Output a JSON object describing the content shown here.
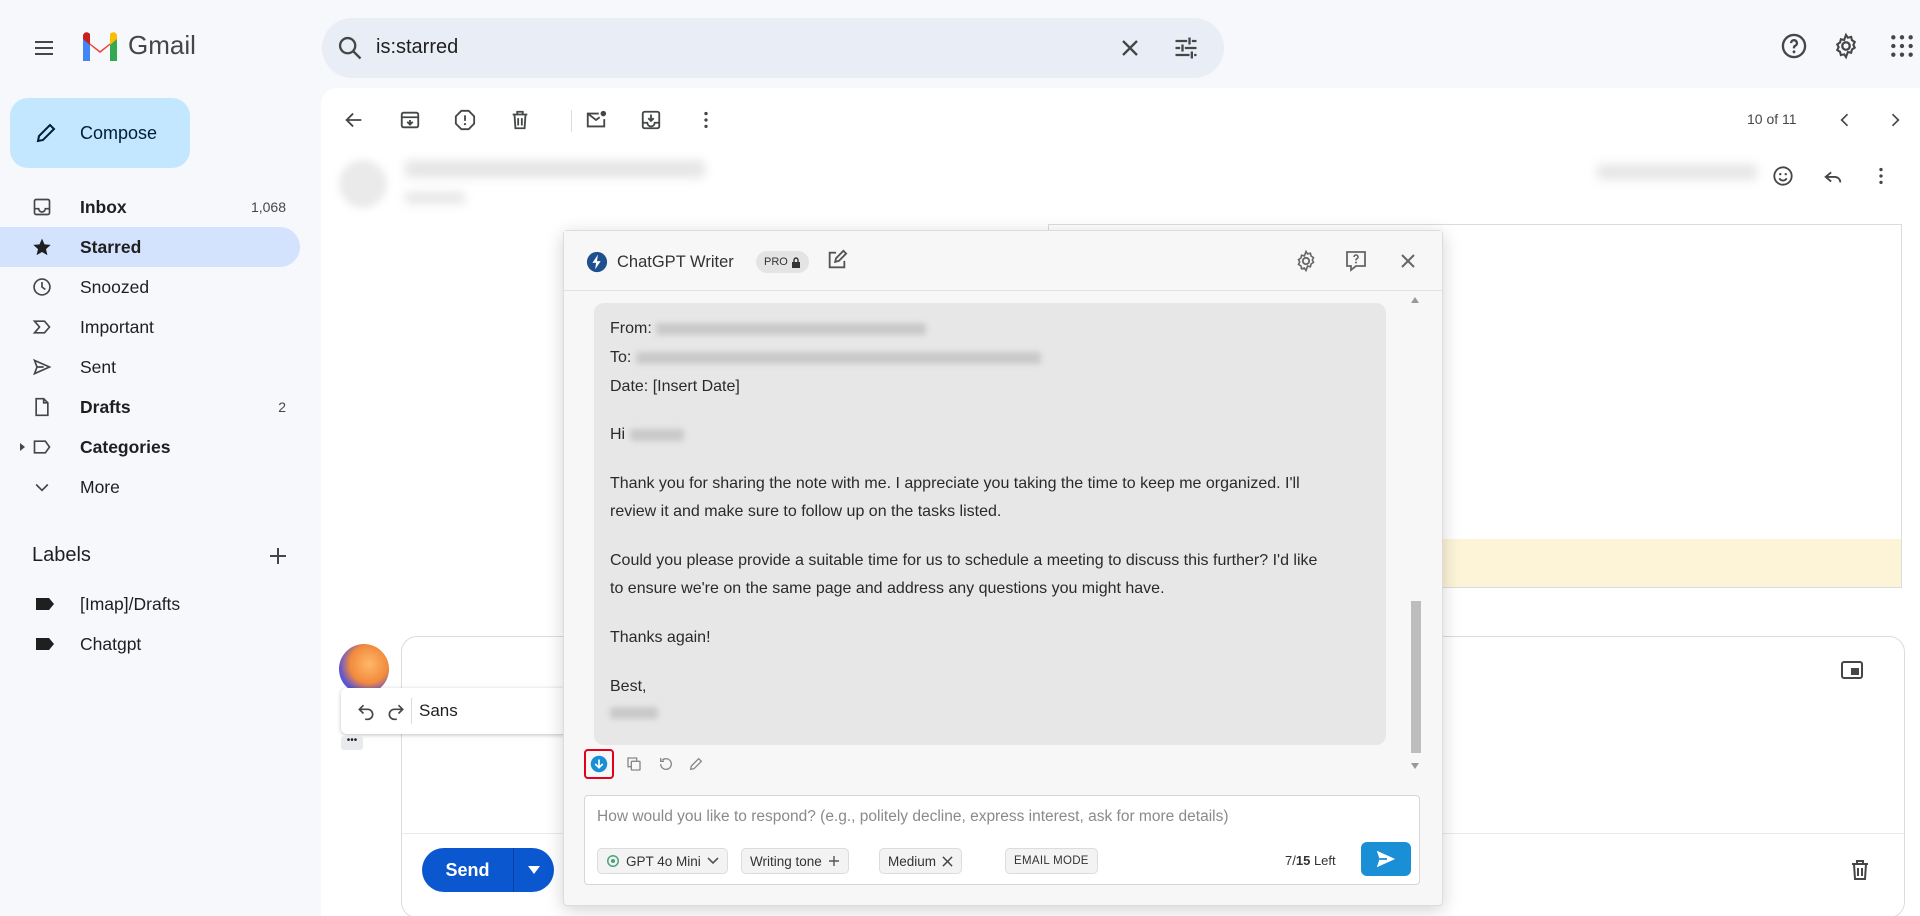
{
  "app": {
    "name": "Gmail"
  },
  "search": {
    "query": "is:starred"
  },
  "compose": {
    "label": "Compose"
  },
  "nav": [
    {
      "label": "Inbox",
      "count": "1,068",
      "bold": true
    },
    {
      "label": "Starred",
      "count": "",
      "bold": true,
      "active": true
    },
    {
      "label": "Snoozed",
      "count": ""
    },
    {
      "label": "Important",
      "count": ""
    },
    {
      "label": "Sent",
      "count": ""
    },
    {
      "label": "Drafts",
      "count": "2",
      "bold": true
    },
    {
      "label": "Categories",
      "count": "",
      "bold": true
    },
    {
      "label": "More",
      "count": ""
    }
  ],
  "labels": {
    "heading": "Labels",
    "items": [
      "[Imap]/Drafts",
      "Chatgpt"
    ]
  },
  "toolbar": {
    "pager": "10 of 11"
  },
  "reply": {
    "font": "Sans",
    "send_label": "Send",
    "more_dots": "•••"
  },
  "gpt_writer": {
    "title": "ChatGPT Writer",
    "pro_badge": "PRO",
    "message": {
      "from_label": "From:",
      "to_label": "To:",
      "date_line": "Date: [Insert Date]",
      "greeting": "Hi",
      "para1_line1": "Thank you for sharing the note with me. I appreciate you taking the time to keep me organized. I'll",
      "para1_line2": "review it and make sure to follow up on the tasks listed.",
      "para2_line1": "Could you please provide a suitable time for us to schedule a meeting to discuss this further? I'd like",
      "para2_line2": "to ensure we're on the same page and address any questions you might have.",
      "thanks": "Thanks again!",
      "signoff": "Best,"
    },
    "input_placeholder": "How would you like to respond? (e.g., politely decline, express interest, ask for more details)",
    "chips": {
      "model": "GPT 4o Mini",
      "tone": "Writing tone",
      "length": "Medium",
      "mode": "EMAIL MODE"
    },
    "usage": {
      "used": "7",
      "total": "15",
      "suffix": "Left"
    }
  },
  "colors": {
    "accent": "#0b57d0",
    "active_nav": "#d3e3fd",
    "compose_bg": "#c2e7ff",
    "gpt_send": "#1a8fd6",
    "highlight_red": "#e3001b"
  }
}
